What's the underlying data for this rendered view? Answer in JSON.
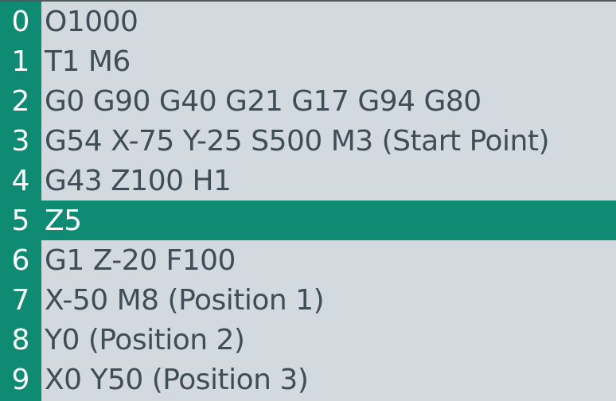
{
  "editor": {
    "lines": [
      {
        "number": "0",
        "code": "O1000",
        "active": false
      },
      {
        "number": "1",
        "code": "T1 M6",
        "active": false
      },
      {
        "number": "2",
        "code": "G0 G90 G40 G21 G17 G94 G80",
        "active": false
      },
      {
        "number": "3",
        "code": "G54 X-75 Y-25 S500 M3 (Start Point)",
        "active": false
      },
      {
        "number": "4",
        "code": "G43 Z100 H1",
        "active": false
      },
      {
        "number": "5",
        "code": "Z5",
        "active": true
      },
      {
        "number": "6",
        "code": "G1 Z-20 F100",
        "active": false
      },
      {
        "number": "7",
        "code": "X-50 M8 (Position 1)",
        "active": false
      },
      {
        "number": "8",
        "code": "Y0 (Position 2)",
        "active": false
      },
      {
        "number": "9",
        "code": "X0 Y50 (Position 3)",
        "active": false
      }
    ]
  },
  "colors": {
    "gutter": "#0f8a73",
    "highlight": "#0f8a73",
    "background": "#d3dadf",
    "text": "#3f4d56"
  }
}
